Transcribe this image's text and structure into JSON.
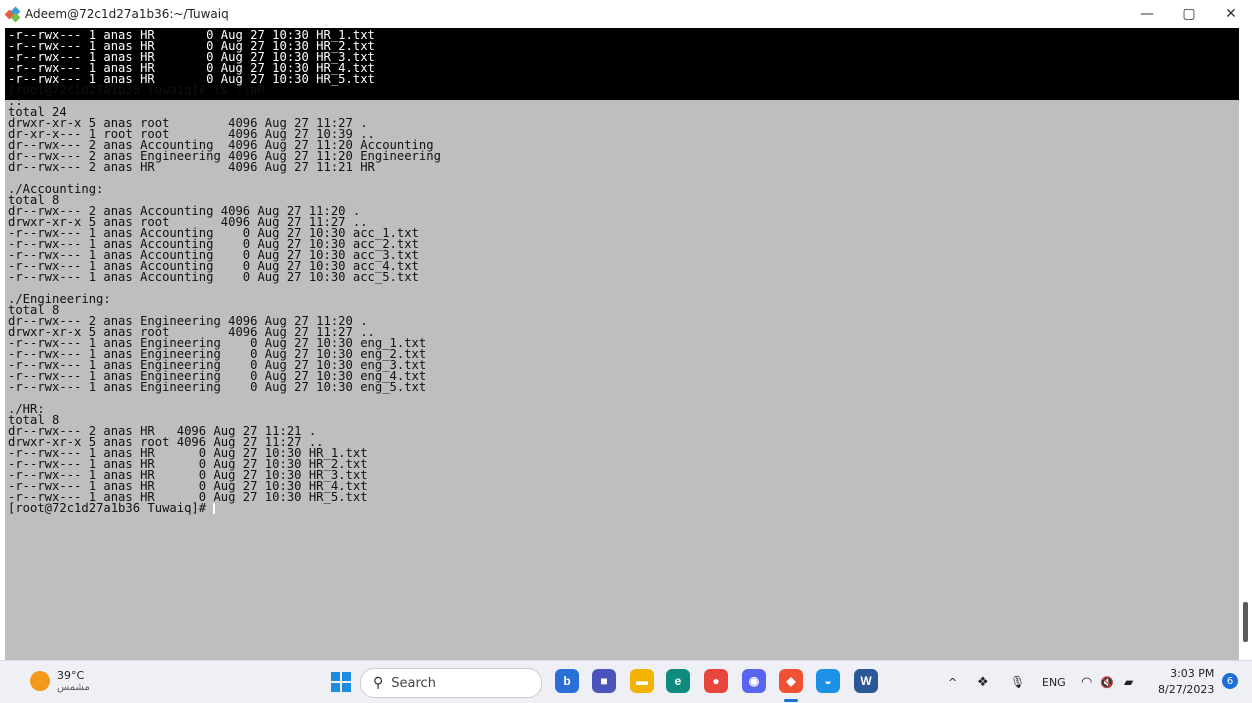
{
  "window": {
    "title": "Adeem@72c1d27a1b36:~/Tuwaiq",
    "controls": {
      "minimize": "—",
      "maximize": "▢",
      "close": "✕"
    }
  },
  "terminal": {
    "scrollback_lines": [
      "-r--rwx--- 1 anas HR       0 Aug 27 10:30 HR_1.txt",
      "-r--rwx--- 1 anas HR       0 Aug 27 10:30 HR_2.txt",
      "-r--rwx--- 1 anas HR       0 Aug 27 10:30 HR_3.txt",
      "-r--rwx--- 1 anas HR       0 Aug 27 10:30 HR_4.txt",
      "-r--rwx--- 1 anas HR       0 Aug 27 10:30 HR_5.txt"
    ],
    "lines": [
      "[root@72c1d27a1b36 Tuwaiq]# ls -laR",
      ".:",
      "total 24",
      "drwxr-xr-x 5 anas root        4096 Aug 27 11:27 .",
      "dr-xr-x--- 1 root root        4096 Aug 27 10:39 ..",
      "dr--rwx--- 2 anas Accounting  4096 Aug 27 11:20 Accounting",
      "dr--rwx--- 2 anas Engineering 4096 Aug 27 11:20 Engineering",
      "dr--rwx--- 2 anas HR          4096 Aug 27 11:21 HR",
      "",
      "./Accounting:",
      "total 8",
      "dr--rwx--- 2 anas Accounting 4096 Aug 27 11:20 .",
      "drwxr-xr-x 5 anas root       4096 Aug 27 11:27 ..",
      "-r--rwx--- 1 anas Accounting    0 Aug 27 10:30 acc_1.txt",
      "-r--rwx--- 1 anas Accounting    0 Aug 27 10:30 acc_2.txt",
      "-r--rwx--- 1 anas Accounting    0 Aug 27 10:30 acc_3.txt",
      "-r--rwx--- 1 anas Accounting    0 Aug 27 10:30 acc_4.txt",
      "-r--rwx--- 1 anas Accounting    0 Aug 27 10:30 acc_5.txt",
      "",
      "./Engineering:",
      "total 8",
      "dr--rwx--- 2 anas Engineering 4096 Aug 27 11:20 .",
      "drwxr-xr-x 5 anas root        4096 Aug 27 11:27 ..",
      "-r--rwx--- 1 anas Engineering    0 Aug 27 10:30 eng_1.txt",
      "-r--rwx--- 1 anas Engineering    0 Aug 27 10:30 eng_2.txt",
      "-r--rwx--- 1 anas Engineering    0 Aug 27 10:30 eng_3.txt",
      "-r--rwx--- 1 anas Engineering    0 Aug 27 10:30 eng_4.txt",
      "-r--rwx--- 1 anas Engineering    0 Aug 27 10:30 eng_5.txt",
      "",
      "./HR:",
      "total 8",
      "dr--rwx--- 2 anas HR   4096 Aug 27 11:21 .",
      "drwxr-xr-x 5 anas root 4096 Aug 27 11:27 ..",
      "-r--rwx--- 1 anas HR      0 Aug 27 10:30 HR_1.txt",
      "-r--rwx--- 1 anas HR      0 Aug 27 10:30 HR_2.txt",
      "-r--rwx--- 1 anas HR      0 Aug 27 10:30 HR_3.txt",
      "-r--rwx--- 1 anas HR      0 Aug 27 10:30 HR_4.txt",
      "-r--rwx--- 1 anas HR      0 Aug 27 10:30 HR_5.txt"
    ],
    "prompt": "[root@72c1d27a1b36 Tuwaiq]# ",
    "colors": {
      "background": "#bebebe",
      "scrollback_bg": "#000000",
      "text": "#111111"
    }
  },
  "taskbar": {
    "weather": {
      "temp": "39°C",
      "condition": "مشمس"
    },
    "search": {
      "placeholder": "Search"
    },
    "apps": [
      {
        "name": "bing-chat",
        "label": "b",
        "color": "#2a6fd6"
      },
      {
        "name": "meet",
        "label": "■",
        "color": "#4b53bc"
      },
      {
        "name": "file-explorer",
        "label": "▬",
        "color": "#f2b400"
      },
      {
        "name": "edge",
        "label": "e",
        "color": "#0f8a7e"
      },
      {
        "name": "chrome",
        "label": "●",
        "color": "#e8453c"
      },
      {
        "name": "discord",
        "label": "◉",
        "color": "#5865f2"
      },
      {
        "name": "git-bash",
        "label": "◆",
        "color": "#f05133"
      },
      {
        "name": "docker",
        "label": "◒",
        "color": "#1d91e6"
      },
      {
        "name": "word",
        "label": "W",
        "color": "#2b5797"
      }
    ],
    "tray": {
      "chevron": "^",
      "dropbox": "❖",
      "mic": "🎙",
      "language": "ENG",
      "wifi": "◠",
      "volume": "🔇",
      "battery": "▰"
    },
    "clock": {
      "time": "3:03 PM",
      "date": "8/27/2023"
    },
    "notifications": "6"
  }
}
